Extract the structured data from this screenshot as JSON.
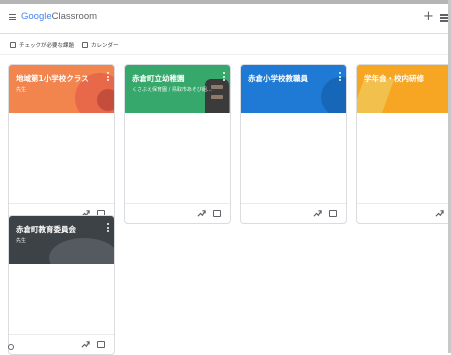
{
  "app": {
    "logo_google": "Google",
    "logo_classroom": "Classroom"
  },
  "icons": {
    "menu": "menu-icon",
    "add": "plus-icon",
    "apps": "apps-icon",
    "todo": "todo-icon",
    "calendar": "calendar-icon",
    "trend": "trend-icon",
    "folder": "folder-icon"
  },
  "subbar": {
    "todo_label": "チェックが必要な課題",
    "calendar_label": "カレンダー"
  },
  "classes": [
    {
      "title": "地域第1小学校クラス",
      "subtitle": "先生",
      "color": "#f2844e"
    },
    {
      "title": "赤倉町立幼稚園",
      "subtitle": "くさぶえ保育園 / 鳥取市あそび組…",
      "color": "#36a86b"
    },
    {
      "title": "赤倉小学校教職員",
      "subtitle": "",
      "color": "#1e7ad4"
    },
    {
      "title": "学年会・校内研修",
      "subtitle": "",
      "color": "#f6a623"
    },
    {
      "title": "赤倉町教育委員会",
      "subtitle": "先生",
      "color": "#3d4247"
    }
  ],
  "plus_label": "+"
}
